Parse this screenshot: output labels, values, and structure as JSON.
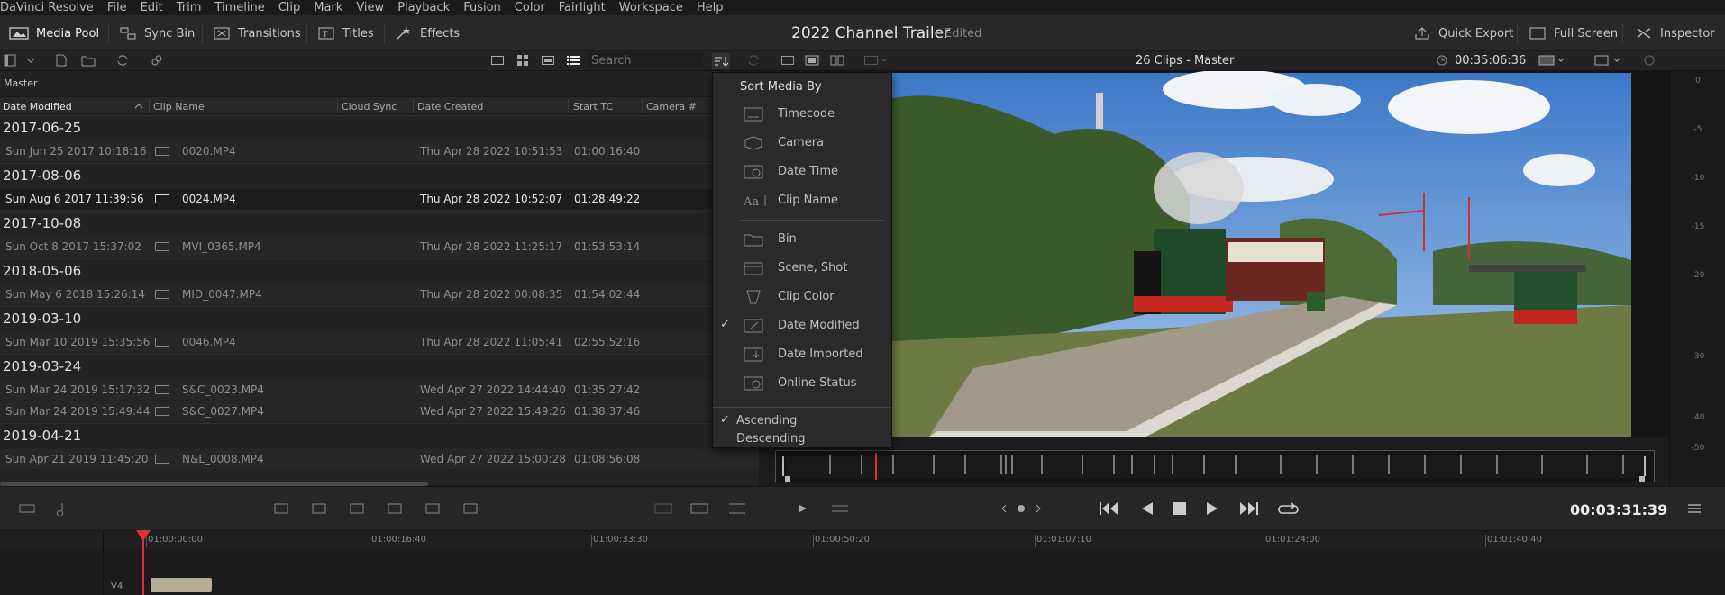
{
  "menubar": {
    "app_name": "DaVinci Resolve",
    "items": [
      "File",
      "Edit",
      "Trim",
      "Timeline",
      "Clip",
      "Mark",
      "View",
      "Playback",
      "Fusion",
      "Color",
      "Fairlight",
      "Workspace",
      "Help"
    ]
  },
  "toolbar": {
    "media_pool": "Media Pool",
    "sync_bin": "Sync Bin",
    "transitions": "Transitions",
    "titles": "Titles",
    "effects": "Effects",
    "project_title": "2022 Channel Trailer",
    "project_status": "Edited",
    "quick_export": "Quick Export",
    "full_screen": "Full Screen",
    "inspector": "Inspector"
  },
  "search": {
    "placeholder": "Search"
  },
  "viewer": {
    "title": "26 Clips - Master",
    "timecode": "00:35:06:36"
  },
  "bin": {
    "label": "Master"
  },
  "columns": [
    "Date Modified",
    "Clip Name",
    "Cloud Sync",
    "Date Created",
    "Start TC",
    "Camera #"
  ],
  "groups": [
    {
      "date": "2017-06-25",
      "rows": [
        {
          "modified": "Sun Jun 25 2017 10:18:16",
          "name": "0020.MP4",
          "created": "Thu Apr 28 2022 10:51:53",
          "tc": "01:00:16:40"
        }
      ]
    },
    {
      "date": "2017-08-06",
      "rows": [
        {
          "modified": "Sun Aug 6 2017 11:39:56",
          "name": "0024.MP4",
          "created": "Thu Apr 28 2022 10:52:07",
          "tc": "01:28:49:22",
          "selected": true
        }
      ]
    },
    {
      "date": "2017-10-08",
      "rows": [
        {
          "modified": "Sun Oct 8 2017 15:37:02",
          "name": "MVI_0365.MP4",
          "created": "Thu Apr 28 2022 11:25:17",
          "tc": "01:53:53:14"
        }
      ]
    },
    {
      "date": "2018-05-06",
      "rows": [
        {
          "modified": "Sun May 6 2018 15:26:14",
          "name": "MID_0047.MP4",
          "created": "Thu Apr 28 2022 00:08:35",
          "tc": "01:54:02:44"
        }
      ]
    },
    {
      "date": "2019-03-10",
      "rows": [
        {
          "modified": "Sun Mar 10 2019 15:35:56",
          "name": "0046.MP4",
          "created": "Thu Apr 28 2022 11:05:41",
          "tc": "02:55:52:16"
        }
      ]
    },
    {
      "date": "2019-03-24",
      "rows": [
        {
          "modified": "Sun Mar 24 2019 15:17:32",
          "name": "S&C_0023.MP4",
          "created": "Wed Apr 27 2022 14:44:40",
          "tc": "01:35:27:42"
        },
        {
          "modified": "Sun Mar 24 2019 15:49:44",
          "name": "S&C_0027.MP4",
          "created": "Wed Apr 27 2022 15:49:26",
          "tc": "01:38:37:46"
        }
      ]
    },
    {
      "date": "2019-04-21",
      "rows": [
        {
          "modified": "Sun Apr 21 2019 11:45:20",
          "name": "N&L_0008.MP4",
          "created": "Wed Apr 27 2022 15:00:28",
          "tc": "01:08:56:08"
        }
      ]
    }
  ],
  "sort_menu": {
    "header": "Sort Media By",
    "items_a": [
      "Timecode",
      "Camera",
      "Date Time",
      "Clip Name"
    ],
    "items_b": [
      "Bin",
      "Scene, Shot",
      "Clip Color",
      "Date Modified",
      "Date Imported",
      "Online Status"
    ],
    "checked_item": "Date Modified",
    "ascending": "Ascending",
    "descending": "Descending"
  },
  "meter": {
    "ticks": [
      "0",
      "-5",
      "-10",
      "-15",
      "-20",
      "-30",
      "-40",
      "-50"
    ]
  },
  "transport": {
    "timecode": "00:03:31:39"
  },
  "timeline": {
    "ruler": [
      "01:00:00:00",
      "01:00:16:40",
      "01:00:33:30",
      "01:00:50:20",
      "01:01:07:10",
      "01:01:24:00",
      "01:01:40:40"
    ],
    "track_label": "V4"
  },
  "colors": {
    "accent": "#d33333",
    "selected_row": "#1c1c1c",
    "clip": "#b8ac92"
  }
}
